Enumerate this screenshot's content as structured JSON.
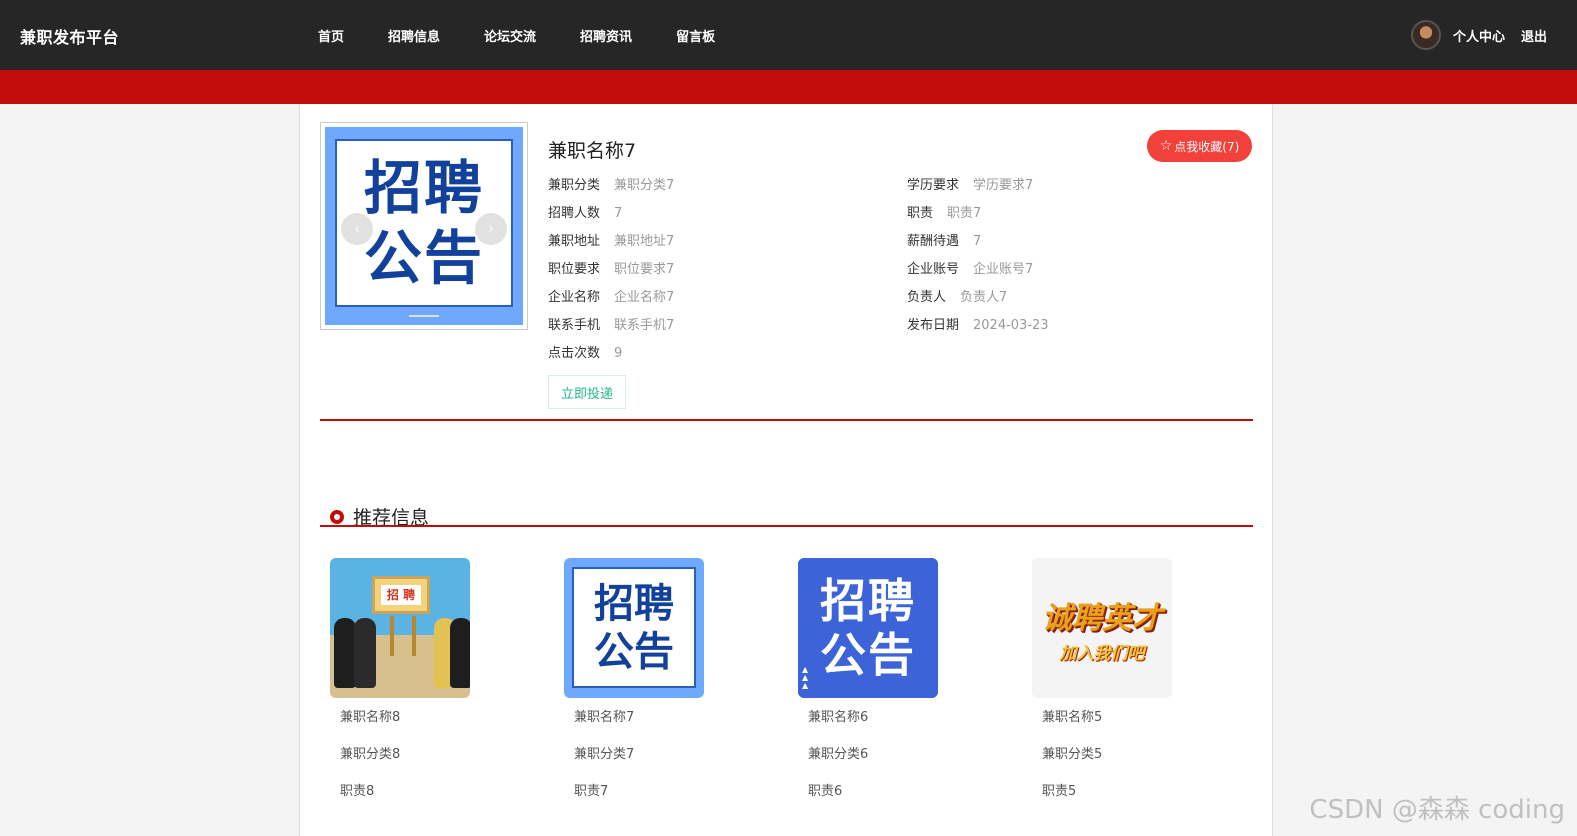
{
  "header": {
    "brand": "兼职发布平台",
    "nav": [
      "首页",
      "招聘信息",
      "论坛交流",
      "招聘资讯",
      "留言板"
    ],
    "user_center": "个人中心",
    "logout": "退出"
  },
  "detail": {
    "title": "兼职名称7",
    "poster_lines": [
      "招聘",
      "公告"
    ],
    "favorite_label": "点我收藏(7)",
    "left_fields": [
      {
        "k": "兼职分类",
        "v": "兼职分类7"
      },
      {
        "k": "招聘人数",
        "v": "7"
      },
      {
        "k": "兼职地址",
        "v": "兼职地址7"
      },
      {
        "k": "职位要求",
        "v": "职位要求7"
      },
      {
        "k": "企业名称",
        "v": "企业名称7"
      },
      {
        "k": "联系手机",
        "v": "联系手机7"
      },
      {
        "k": "点击次数",
        "v": "9"
      }
    ],
    "right_fields": [
      {
        "k": "学历要求",
        "v": "学历要求7"
      },
      {
        "k": "职责",
        "v": "职责7"
      },
      {
        "k": "薪酬待遇",
        "v": "7"
      },
      {
        "k": "企业账号",
        "v": "企业账号7"
      },
      {
        "k": "负责人",
        "v": "负责人7"
      },
      {
        "k": "发布日期",
        "v": "2024-03-23"
      }
    ],
    "apply_label": "立即投递"
  },
  "recommend": {
    "title": "推荐信息",
    "cards": [
      {
        "name": "兼职名称8",
        "category": "兼职分类8",
        "duty": "职责8",
        "thumb_text": "招 聘"
      },
      {
        "name": "兼职名称7",
        "category": "兼职分类7",
        "duty": "职责7",
        "thumb_text": "招聘 公告"
      },
      {
        "name": "兼职名称6",
        "category": "兼职分类6",
        "duty": "职责6",
        "thumb_text": "招聘 公告"
      },
      {
        "name": "兼职名称5",
        "category": "兼职分类5",
        "duty": "职责5",
        "thumb_text": "诚聘英才 加入我们吧"
      }
    ]
  },
  "watermark": "CSDN @森森 coding",
  "colors": {
    "header_bg": "#262626",
    "accent_red": "#c20c0c",
    "favorite_bg": "#f2403b",
    "apply_text": "#25b78f"
  }
}
